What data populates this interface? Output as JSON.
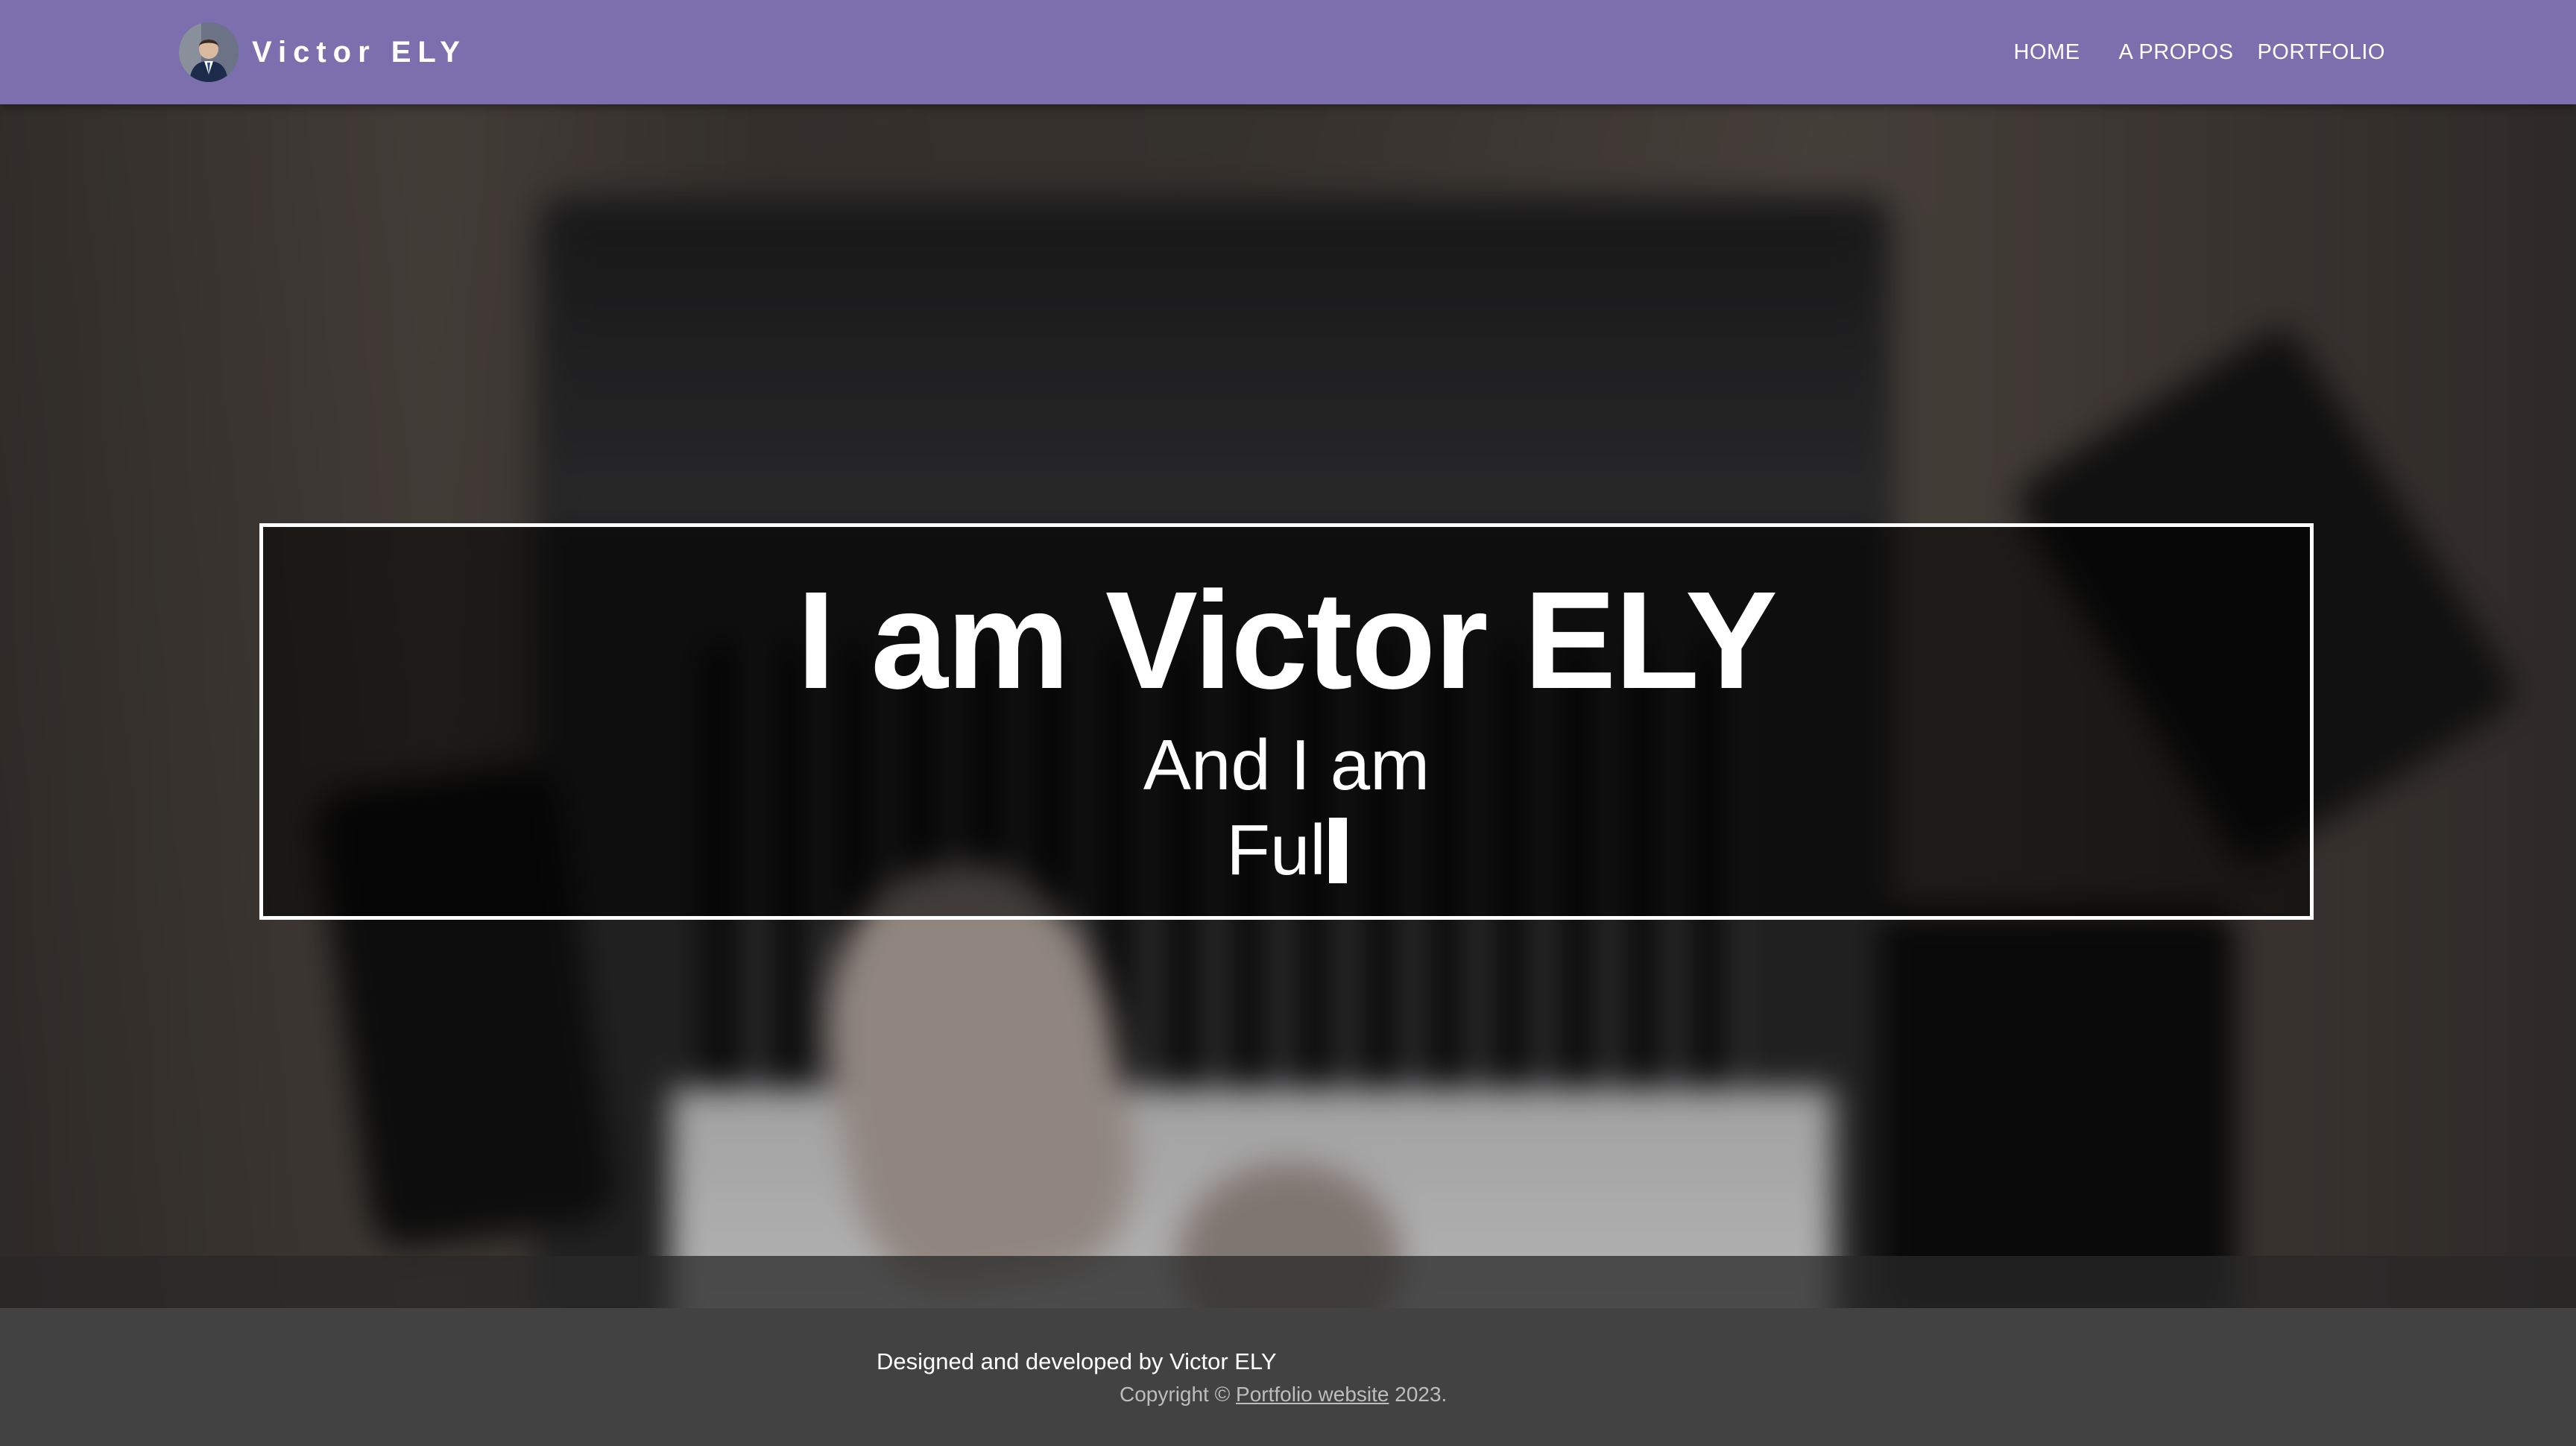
{
  "navbar": {
    "brand_name": "Victor ELY",
    "avatar_icon": "profile-photo",
    "links": [
      {
        "label": "HOME"
      },
      {
        "label": "A PROPOS"
      },
      {
        "label": "PORTFOLIO"
      }
    ],
    "background_color": "#7b6fae"
  },
  "hero": {
    "title": "I am Victor ELY",
    "subtitle": "And I am",
    "typed_text": "Ful",
    "box_border_color": "#ffffff"
  },
  "footer": {
    "credit": "Designed and developed by Victor ELY",
    "copyright_prefix": "Copyright ©",
    "copyright_link": "Portfolio website",
    "copyright_suffix": "2023.",
    "background_color": "#424242"
  }
}
